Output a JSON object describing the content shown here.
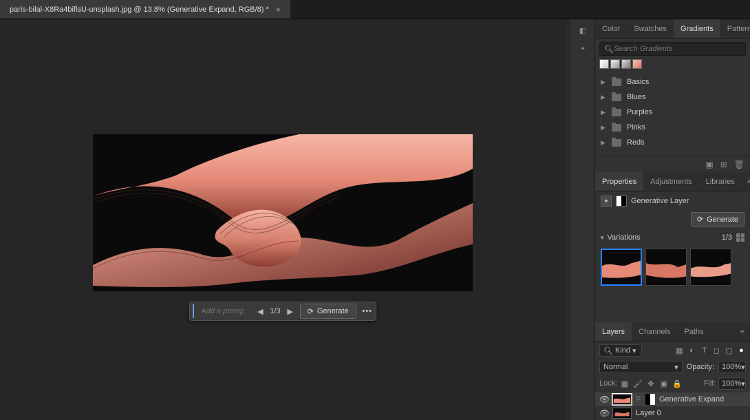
{
  "tab": {
    "title": "paris-bilal-X8Ra4biflsU-unsplash.jpg @ 13.8% (Generative Expand, RGB/8) *"
  },
  "prompt": {
    "placeholder": "Add a prompt...",
    "value": "",
    "counter": "1/3",
    "generate": "Generate"
  },
  "gradientsPanel": {
    "tabs": {
      "color": "Color",
      "swatches": "Swatches",
      "gradients": "Gradients",
      "patterns": "Patterns"
    },
    "searchPlaceholder": "Search Gradients",
    "swatches": [
      "#dddddd",
      "#cccccc",
      "#bbbbbb",
      "#e89a88"
    ],
    "folders": [
      "Basics",
      "Blues",
      "Purples",
      "Pinks",
      "Reds"
    ]
  },
  "propsPanel": {
    "tabs": {
      "properties": "Properties",
      "adjustments": "Adjustments",
      "libraries": "Libraries"
    },
    "layerType": "Generative Layer",
    "generate": "Generate",
    "variationsLabel": "Variations",
    "variationsCounter": "1/3"
  },
  "layersPanel": {
    "tabs": {
      "layers": "Layers",
      "channels": "Channels",
      "paths": "Paths"
    },
    "kind": "Kind",
    "blend": "Normal",
    "opacityLabel": "Opacity:",
    "opacity": "100%",
    "lockLabel": "Lock:",
    "fillLabel": "Fill:",
    "fill": "100%",
    "entries": [
      {
        "name": "Generative Expand"
      },
      {
        "name": "Layer 0"
      }
    ]
  }
}
